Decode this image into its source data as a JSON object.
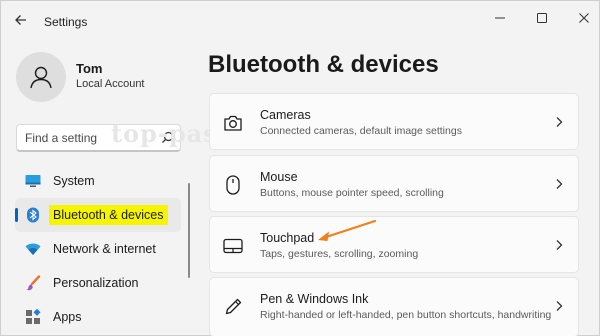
{
  "window": {
    "title": "Settings"
  },
  "user": {
    "name": "Tom",
    "account_type": "Local Account"
  },
  "search": {
    "placeholder": "Find a setting"
  },
  "watermark": "top-password.com",
  "nav": {
    "items": [
      {
        "label": "System",
        "icon": "monitor-icon",
        "selected": false
      },
      {
        "label": "Bluetooth & devices",
        "icon": "bluetooth-icon",
        "selected": true
      },
      {
        "label": "Network & internet",
        "icon": "wifi-icon",
        "selected": false
      },
      {
        "label": "Personalization",
        "icon": "brush-icon",
        "selected": false
      },
      {
        "label": "Apps",
        "icon": "apps-icon",
        "selected": false
      }
    ]
  },
  "page": {
    "title": "Bluetooth & devices"
  },
  "cards": [
    {
      "title": "Cameras",
      "subtitle": "Connected cameras, default image settings",
      "icon": "camera-icon"
    },
    {
      "title": "Mouse",
      "subtitle": "Buttons, mouse pointer speed, scrolling",
      "icon": "mouse-icon"
    },
    {
      "title": "Touchpad",
      "subtitle": "Taps, gestures, scrolling, zooming",
      "icon": "touchpad-icon"
    },
    {
      "title": "Pen & Windows Ink",
      "subtitle": "Right-handed or left-handed, pen button shortcuts, handwriting",
      "icon": "pen-icon"
    }
  ],
  "colors": {
    "accent": "#0067c0",
    "highlight": "#f5f500",
    "annotation_arrow": "#f07f1c"
  }
}
